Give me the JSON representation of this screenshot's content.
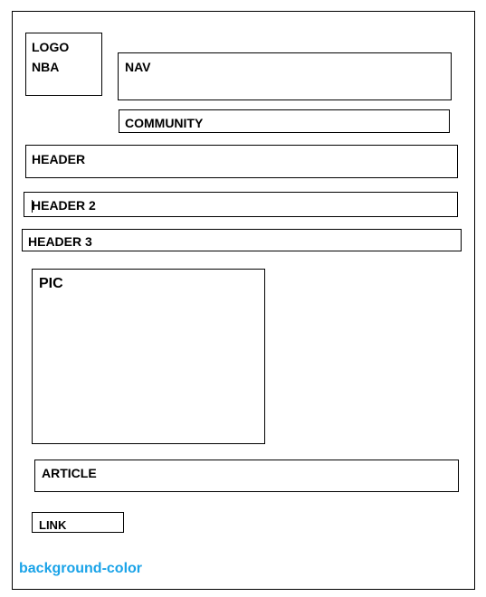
{
  "logo": {
    "line1": "LOGO",
    "line2": "NBA"
  },
  "nav": {
    "label": "NAV"
  },
  "community": {
    "label": "COMMUNITY"
  },
  "header": {
    "label": "HEADER"
  },
  "header2": {
    "label": "HEADER 2"
  },
  "header3": {
    "label": "HEADER 3"
  },
  "pic": {
    "label": "PIC"
  },
  "article": {
    "label": "ARTICLE"
  },
  "link": {
    "label": "LINK"
  },
  "background_note": {
    "label": "background-color",
    "color": "#1aa3e8"
  }
}
